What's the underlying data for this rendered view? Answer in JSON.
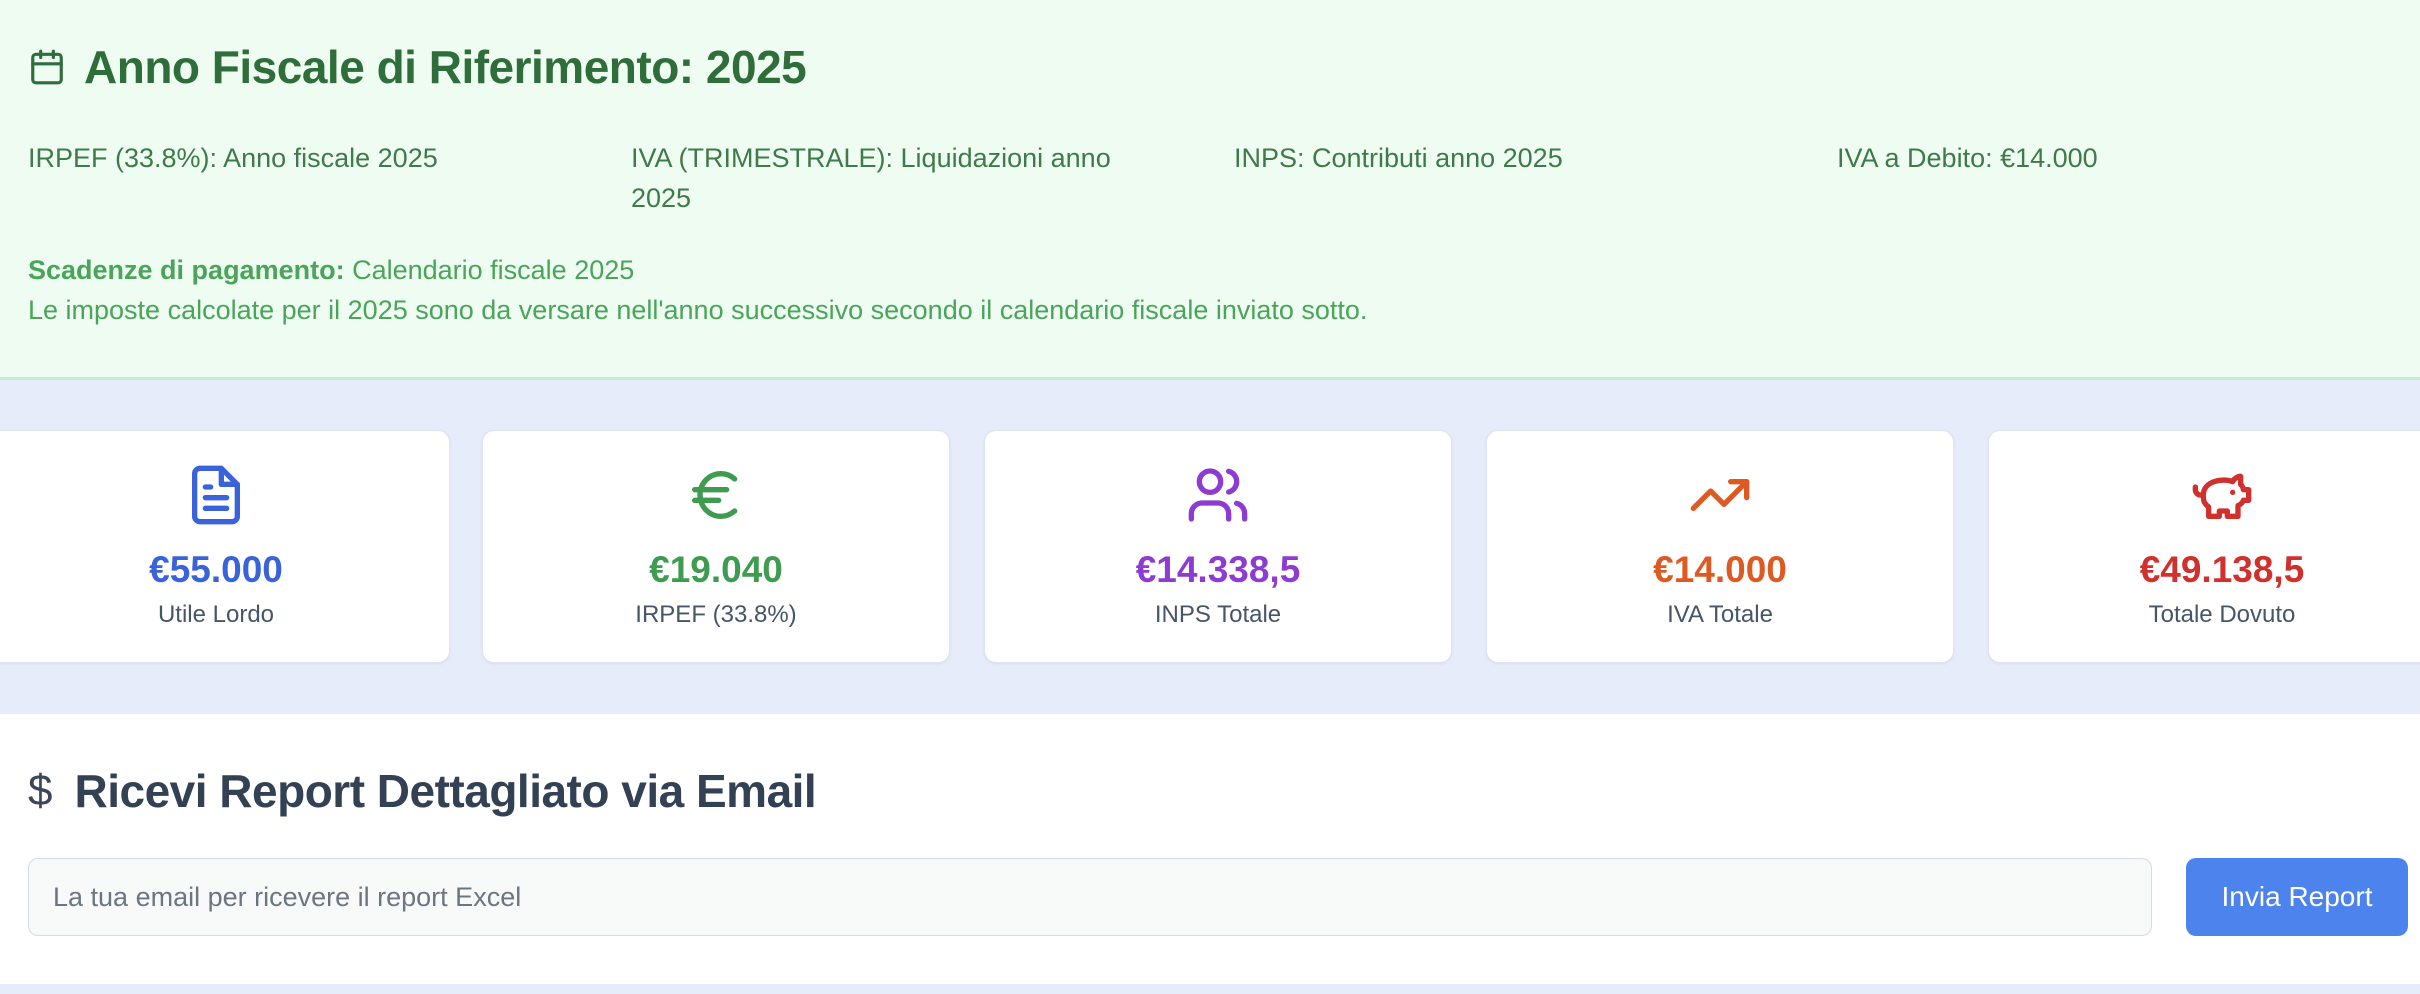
{
  "fiscal": {
    "title": "Anno Fiscale di Riferimento: 2025",
    "icon": "calendar-icon",
    "info": [
      "IRPEF (33.8%): Anno fiscale 2025",
      "IVA (TRIMESTRALE): Liquidazioni anno 2025",
      "INPS: Contributi anno 2025",
      "IVA a Debito: €14.000"
    ],
    "deadline_label": "Scadenze di pagamento:",
    "deadline_value": " Calendario fiscale 2025",
    "note": "Le imposte calcolate per il 2025 sono da versare nell'anno successivo secondo il calendario fiscale inviato sotto.",
    "colors": {
      "background": "#eefcf2",
      "title": "#2f6d3b",
      "accent": "#4aa55a"
    }
  },
  "cards": [
    {
      "icon": "document-icon",
      "value": "€55.000",
      "label": "Utile Lordo",
      "color": "#3b63d9"
    },
    {
      "icon": "euro-icon",
      "value": "€19.040",
      "label": "IRPEF (33.8%)",
      "color": "#3e9b4f"
    },
    {
      "icon": "users-icon",
      "value": "€14.338,5",
      "label": "INPS Totale",
      "color": "#8e3bd1"
    },
    {
      "icon": "trending-up-icon",
      "value": "€14.000",
      "label": "IVA Totale",
      "color": "#dd5b22"
    },
    {
      "icon": "piggy-bank-icon",
      "value": "€49.138,5",
      "label": "Totale Dovuto",
      "color": "#d0312d"
    }
  ],
  "report": {
    "icon": "dollar-icon",
    "icon_glyph": "$",
    "title": "Ricevi Report Dettagliato via Email",
    "email_value": "",
    "email_placeholder": "La tua email per ricevere il report Excel",
    "button_label": "Invia Report",
    "button_color": "#4d83ed"
  }
}
